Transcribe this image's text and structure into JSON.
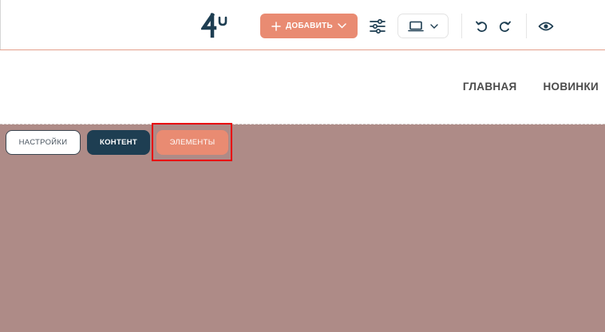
{
  "toolbar": {
    "logo_text": "4u",
    "add_label": "ДОБАВИТЬ",
    "icons": {
      "add": "plus-icon",
      "add_dropdown": "chevron-down-icon",
      "settings": "sliders-icon",
      "device": "laptop-icon",
      "device_dropdown": "chevron-down-icon",
      "undo": "undo-icon",
      "redo": "redo-icon",
      "preview": "eye-icon"
    }
  },
  "site": {
    "nav": [
      "ГЛАВНАЯ",
      "НОВИНКИ"
    ]
  },
  "section": {
    "tabs": {
      "settings": "НАСТРОЙКИ",
      "content": "КОНТЕНТ",
      "elements": "ЭЛЕМЕНТЫ"
    }
  },
  "colors": {
    "accent": "#e98b72",
    "dark": "#1e3e52",
    "section_bg": "#ae8b87",
    "highlight": "#e8000d"
  }
}
